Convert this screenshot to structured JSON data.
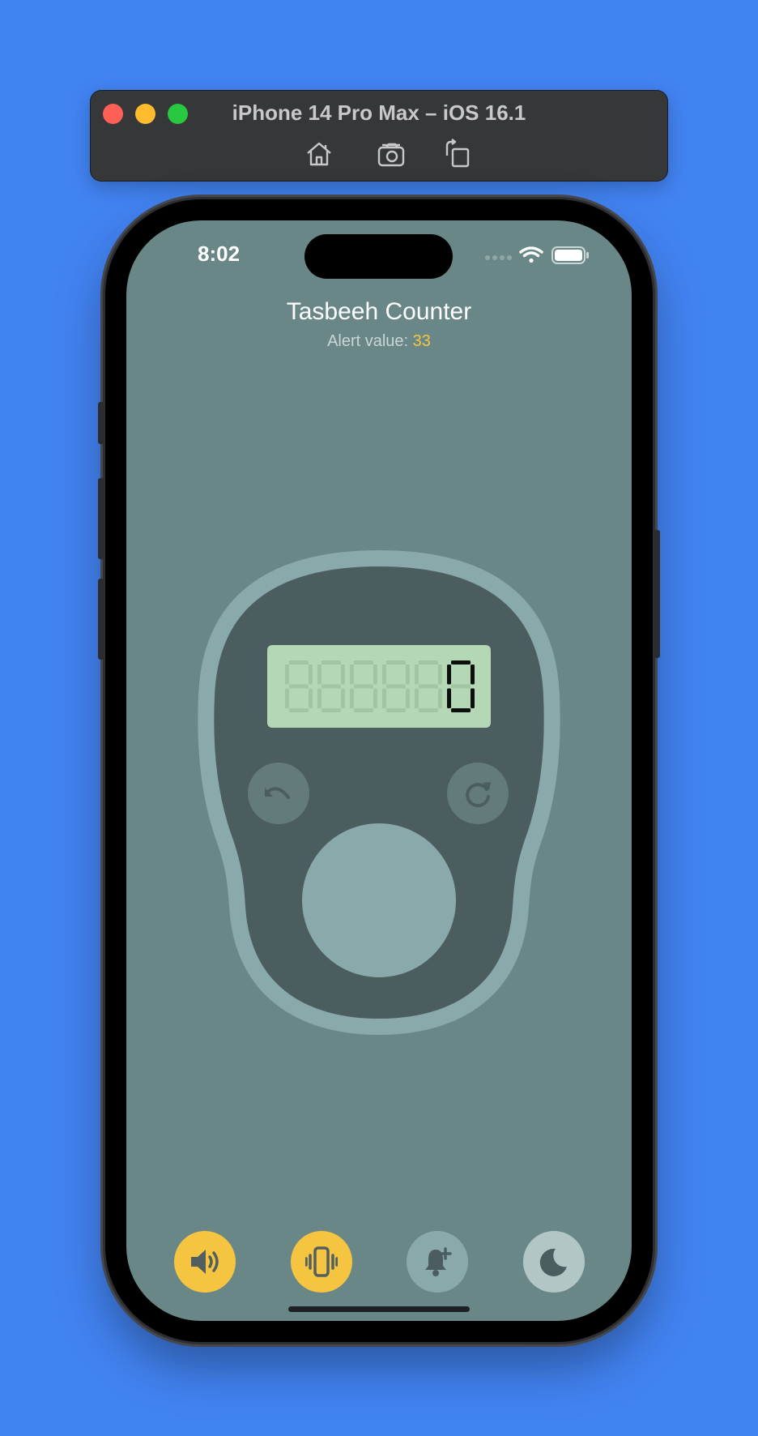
{
  "simulator": {
    "title": "iPhone 14 Pro Max – iOS 16.1",
    "tools": [
      "home-icon",
      "screenshot-icon",
      "rotate-icon"
    ]
  },
  "status_bar": {
    "time": "8:02",
    "icons": [
      "signal-dots-icon",
      "wifi-icon",
      "battery-icon"
    ]
  },
  "app": {
    "title": "Tasbeeh Counter",
    "alert_label": "Alert value: ",
    "alert_value": "33",
    "counter": {
      "value": "0",
      "digits": 6
    },
    "device_buttons": [
      "undo-icon",
      "reset-icon"
    ],
    "bottom_buttons": [
      {
        "icon": "speaker-icon",
        "active": true
      },
      {
        "icon": "vibrate-icon",
        "active": true
      },
      {
        "icon": "bell-plus-icon",
        "active": false
      },
      {
        "icon": "moon-icon",
        "active": false
      }
    ],
    "colors": {
      "background": "#6a8787",
      "device_body": "#4b5d5f",
      "device_rim": "#89a9aa",
      "lcd": "#b4d7b6",
      "accent": "#f5c542"
    }
  }
}
